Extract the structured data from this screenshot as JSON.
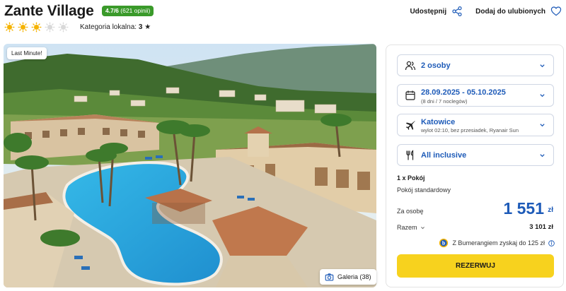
{
  "header": {
    "title": "Zante Village",
    "rating": "4.7/6",
    "reviews": "(621 opinii)",
    "sun_rating": 3,
    "sun_max": 5,
    "local_category_label": "Kategoria lokalna:",
    "local_category_value": "3",
    "share_label": "Udostępnij",
    "favorite_label": "Dodaj do ulubionych"
  },
  "photo": {
    "badge": "Last Minute!",
    "gallery_label": "Galeria (38)"
  },
  "booking": {
    "guests": "2 osoby",
    "dates": "28.09.2025 - 05.10.2025",
    "dates_sub": "(8 dni / 7 noclegów)",
    "departure": "Katowice",
    "departure_sub": "wylot 02:10, bez przesiadek, Ryanair Sun",
    "board": "All inclusive",
    "room_count": "1 x Pokój",
    "room_type": "Pokój standardowy",
    "per_person_label": "Za osobę",
    "price": "1 551",
    "currency": "zł",
    "total_label": "Razem",
    "total_value": "3 101 zł",
    "bumerang_text": "Z Bumerangiem zyskaj do 125 zł",
    "reserve_label": "REZERWUJ"
  },
  "colors": {
    "accent": "#1e5bb8",
    "rating_green": "#3a9a2a",
    "cta_yellow": "#f7d21e",
    "sun_active": "#f5b300",
    "sun_inactive": "#d9d9d9"
  }
}
